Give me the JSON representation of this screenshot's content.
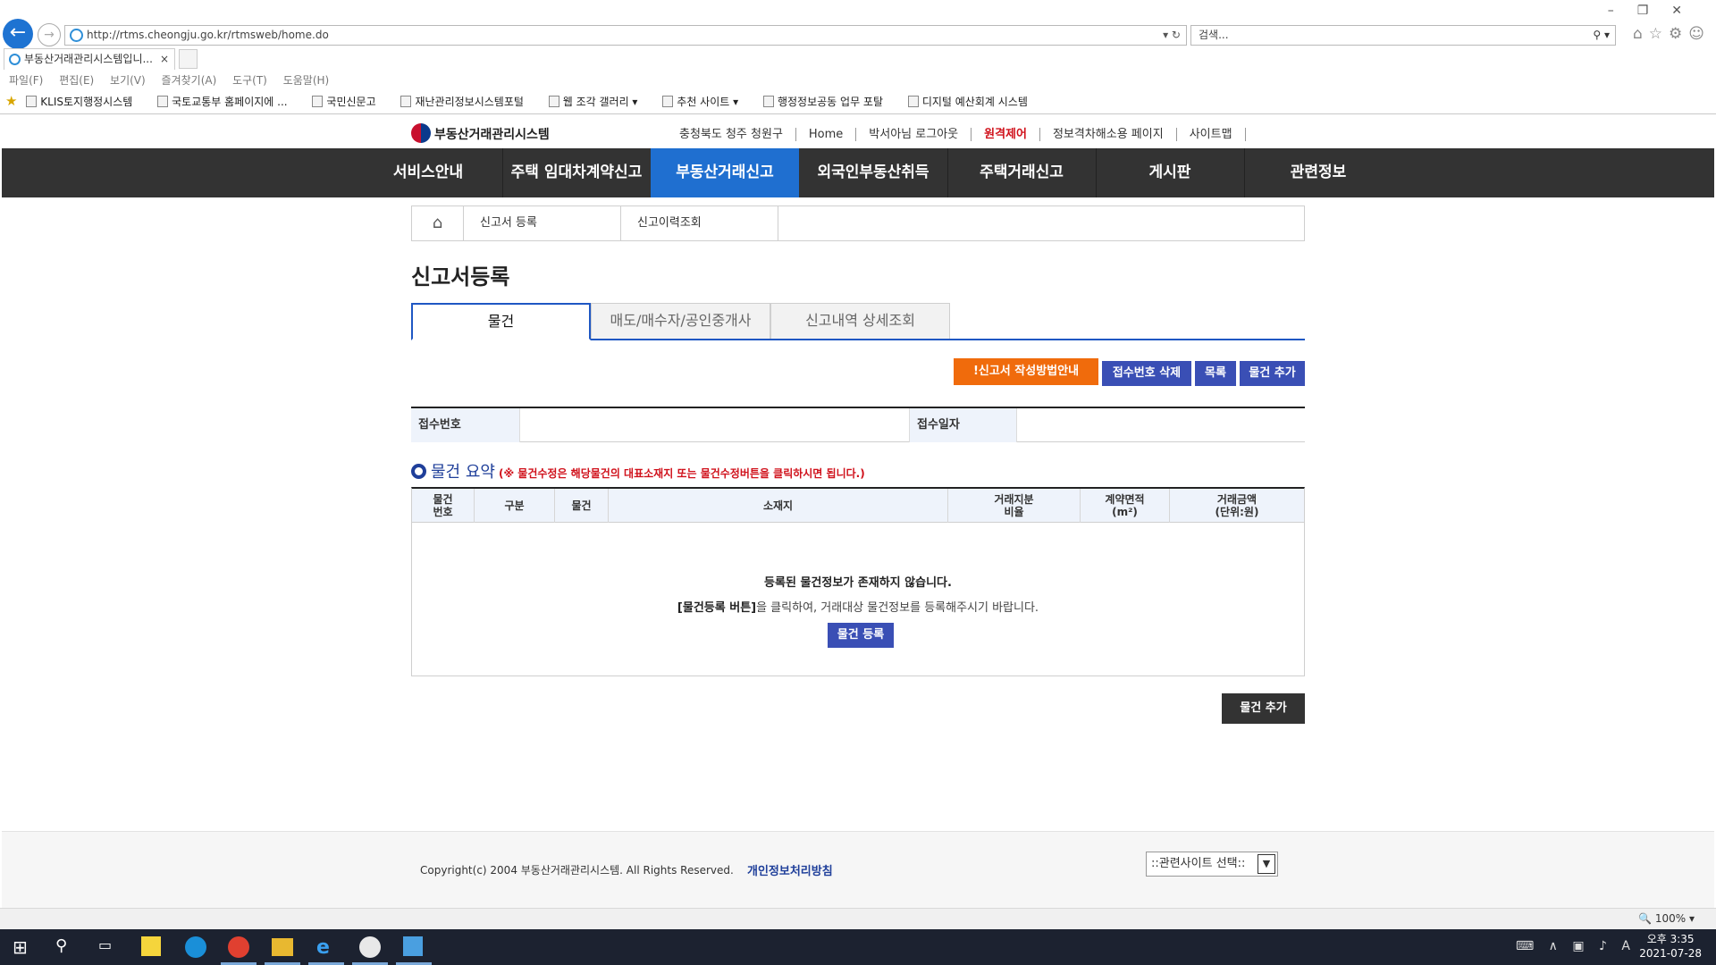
{
  "browser": {
    "url": "http://rtms.cheongju.go.kr/rtmsweb/home.do",
    "search_placeholder": "검색...",
    "tab_title": "부동산거래관리시스템입니...",
    "tab_close": "×",
    "menu": [
      "파일(F)",
      "편집(E)",
      "보기(V)",
      "즐겨찾기(A)",
      "도구(T)",
      "도움말(H)"
    ],
    "favorites": [
      "KLIS토지행정시스템",
      "국토교통부 홈페이지에 ...",
      "국민신문고",
      "재난관리정보시스템포털",
      "웹 조각 갤러리 ▾",
      "추천 사이트 ▾",
      "행정정보공동 업무 포탈",
      "디지털 예산회계 시스템"
    ],
    "zoom": "100%"
  },
  "site": {
    "logo": "부동산거래관리시스템",
    "util": [
      "충청북도 청주 청원구",
      "Home",
      "박서아님 로그아웃",
      "원격제어",
      "정보격차해소용 페이지",
      "사이트맵"
    ],
    "gnb": [
      "서비스안내",
      "주택 임대차계약신고",
      "부동산거래신고",
      "외국인부동산취득",
      "주택거래신고",
      "게시판",
      "관련정보"
    ],
    "active_gnb": 2
  },
  "breadcrumb": {
    "c1": "신고서 등록",
    "c2": "신고이력조회"
  },
  "page_title": "신고서등록",
  "tabs": [
    "물건",
    "매도/매수자/공인중개사",
    "신고내역 상세조회"
  ],
  "buttons": {
    "guide": "!신고서 작성방법안내",
    "delete_receipt": "접수번호 삭제",
    "list": "목록",
    "add_item": "물건 추가",
    "add_item_bottom": "물건 추가",
    "register_item": "물건 등록"
  },
  "info": {
    "receipt_no_label": "접수번호",
    "receipt_no": "",
    "receipt_date_label": "접수일자",
    "receipt_date": ""
  },
  "summary": {
    "title": "물건 요약",
    "note": "(※ 물건수정은 해당물건의 대표소재지 또는 물건수정버튼을 클릭하시면 됩니다.)",
    "columns": [
      "물건\n번호",
      "구분",
      "물건",
      "소재지",
      "거래지분\n비율",
      "계약면적\n(m²)",
      "거래금액\n(단위:원)"
    ],
    "empty_main": "등록된 물건정보가 존재하지 않습니다.",
    "empty_hint_bold": "[물건등록 버튼]",
    "empty_hint_rest": "을 클릭하여, 거래대상 물건정보를 등록해주시기 바랍니다."
  },
  "footer": {
    "copyright": "Copyright(c) 2004 부동산거래관리시스템. All Rights Reserved.",
    "privacy": "개인정보처리방침",
    "related_select": "::관련사이트 선택::"
  },
  "taskbar": {
    "time": "오후 3:35",
    "date": "2021-07-28"
  },
  "colors": {
    "active_menu": "#1f6fd0",
    "guide_button": "#f06b0c",
    "action_button": "#3a4fb5",
    "gnb_bg": "#333333"
  }
}
